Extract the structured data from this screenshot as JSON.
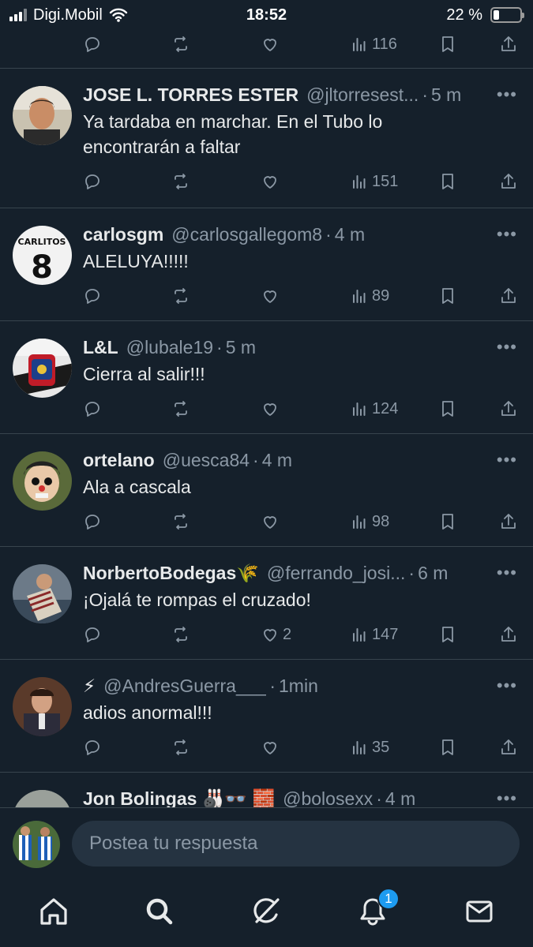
{
  "status_bar": {
    "carrier": "Digi.Mobil",
    "time": "18:52",
    "battery_text": "22 %",
    "battery_level": 0.22
  },
  "feed": {
    "top_partial_tweet": {
      "views": "116"
    },
    "tweets": [
      {
        "name": "JOSE L. TORRES ESTER",
        "handle": "@jltorresest...",
        "time": "5 m",
        "text_lines": [
          "Ya tardaba en marchar. En el Tubo lo",
          "encontrarán a faltar"
        ],
        "likes": "",
        "views": "151"
      },
      {
        "name": "carlosgm",
        "handle": "@carlosgallegom8",
        "time": "4 m",
        "text_lines": [
          "ALELUYA!!!!!"
        ],
        "likes": "",
        "views": "89"
      },
      {
        "name": "L&L",
        "handle": "@lubale19",
        "time": "5 m",
        "text_lines": [
          "Cierra al salir!!!"
        ],
        "likes": "",
        "views": "124"
      },
      {
        "name": "ortelano",
        "handle": "@uesca84",
        "time": "4 m",
        "text_lines": [
          "Ala a cascala"
        ],
        "likes": "",
        "views": "98"
      },
      {
        "name": "NorbertoBodegas🌾",
        "handle": "@ferrando_josi...",
        "time": "6 m",
        "text_lines": [
          "¡Ojalá te rompas el cruzado!"
        ],
        "likes": "2",
        "views": "147"
      },
      {
        "name": "⚡",
        "handle": "@AndresGuerra___",
        "time": "1min",
        "text_lines": [
          "adios anormal!!!"
        ],
        "likes": "",
        "views": "35"
      },
      {
        "name": "Jon Bolingas 🎳👓 🧱",
        "handle": "@bolosexx",
        "time": "4 m",
        "text_lines": [],
        "likes": "",
        "views": ""
      }
    ],
    "more_symbol": "•••",
    "separator": "·"
  },
  "reply": {
    "placeholder": "Postea tu respuesta"
  },
  "nav": {
    "notifications_badge": "1",
    "active": "search"
  },
  "colors": {
    "background": "#15202b",
    "divider": "#38444d",
    "secondary_text": "#8b98a5",
    "accent": "#1d9bf0"
  }
}
